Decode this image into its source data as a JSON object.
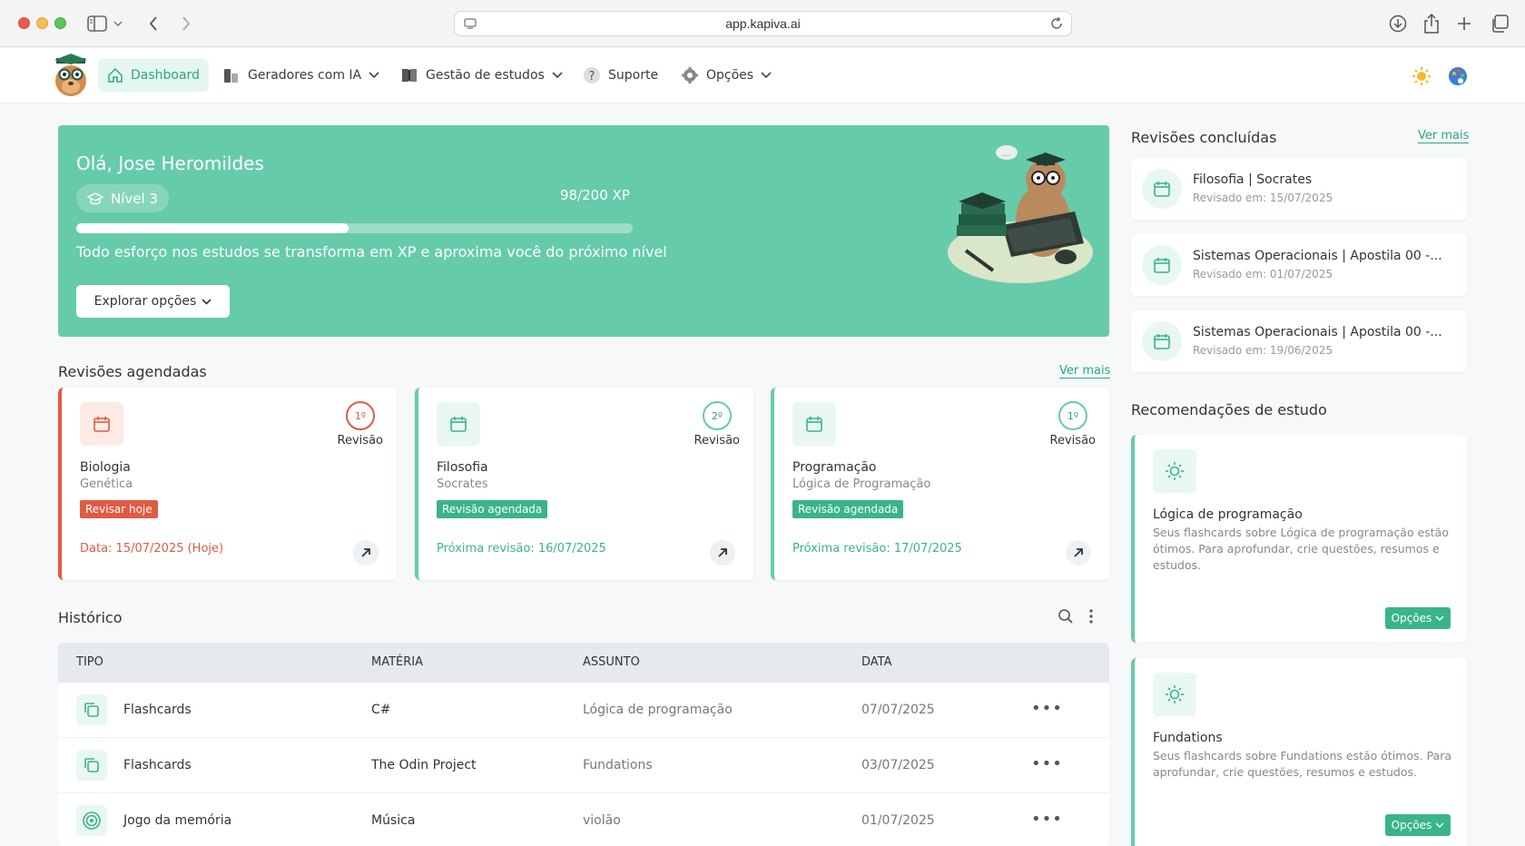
{
  "browser": {
    "url": "app.kapiva.ai"
  },
  "nav": {
    "items": [
      {
        "label": "Dashboard",
        "icon": "home-icon"
      },
      {
        "label": "Geradores com IA",
        "icon": "generator-icon"
      },
      {
        "label": "Gestão de estudos",
        "icon": "book-icon"
      },
      {
        "label": "Suporte",
        "icon": "help-icon"
      },
      {
        "label": "Opções",
        "icon": "gear-icon"
      }
    ]
  },
  "hero": {
    "greeting_prefix": "Olá, ",
    "user_name": "Jose Heromildes",
    "level": "Nível 3",
    "xp": "98/200 XP",
    "xp_progress": 0.49,
    "message": "Todo esforço nos estudos se transforma em XP e aproxima você do próximo nível",
    "explore_label": "Explorar opções"
  },
  "scheduled": {
    "title": "Revisões agendadas",
    "see_more": "Ver mais",
    "cards": [
      {
        "revision": "1º",
        "revision_label": "Revisão",
        "subject": "Biologia",
        "topic": "Genética",
        "badge": "Revisar hoje",
        "date": "Data: 15/07/2025 (Hoje)",
        "urgent": true
      },
      {
        "revision": "2º",
        "revision_label": "Revisão",
        "subject": "Filosofia",
        "topic": "Socrates",
        "badge": "Revisão agendada",
        "date": "Próxima revisão: 16/07/2025",
        "urgent": false
      },
      {
        "revision": "1º",
        "revision_label": "Revisão",
        "subject": "Programação",
        "topic": "Lógica de Programação",
        "badge": "Revisão agendada",
        "date": "Próxima revisão: 17/07/2025",
        "urgent": false
      }
    ]
  },
  "history": {
    "title": "Histórico",
    "columns": [
      "TIPO",
      "MATÉRIA",
      "ASSUNTO",
      "DATA"
    ],
    "rows": [
      {
        "type": "Flashcards",
        "subject": "C#",
        "topic": "Lógica de programação",
        "date": "07/07/2025",
        "icon": "copy-icon"
      },
      {
        "type": "Flashcards",
        "subject": "The Odin Project",
        "topic": "Fundations",
        "date": "03/07/2025",
        "icon": "copy-icon"
      },
      {
        "type": "Jogo da memória",
        "subject": "Música",
        "topic": "violão",
        "date": "01/07/2025",
        "icon": "target-icon"
      }
    ]
  },
  "completed": {
    "title": "Revisões concluídas",
    "see_more": "Ver mais",
    "items": [
      {
        "title": "Filosofia | Socrates",
        "date": "Revisado em: 15/07/2025"
      },
      {
        "title": "Sistemas Operacionais | Apostila 00 -...",
        "date": "Revisado em: 01/07/2025"
      },
      {
        "title": "Sistemas Operacionais | Apostila 00 -...",
        "date": "Revisado em: 19/06/2025"
      }
    ]
  },
  "recommendations": {
    "title": "Recomendações de estudo",
    "items": [
      {
        "title": "Lógica de programação",
        "desc": "Seus flashcards sobre Lógica de programação estão ótimos. Para aprofundar, crie questões, resumos e estudos.",
        "button": "Opções"
      },
      {
        "title": "Fundations",
        "desc": "Seus flashcards sobre Fundations estão ótimos. Para aprofundar, crie questões, resumos e estudos.",
        "button": "Opções"
      }
    ]
  },
  "colors": {
    "accent": "#66cbaa",
    "accent_dark": "#3ab48a",
    "urgent": "#e05a44"
  }
}
